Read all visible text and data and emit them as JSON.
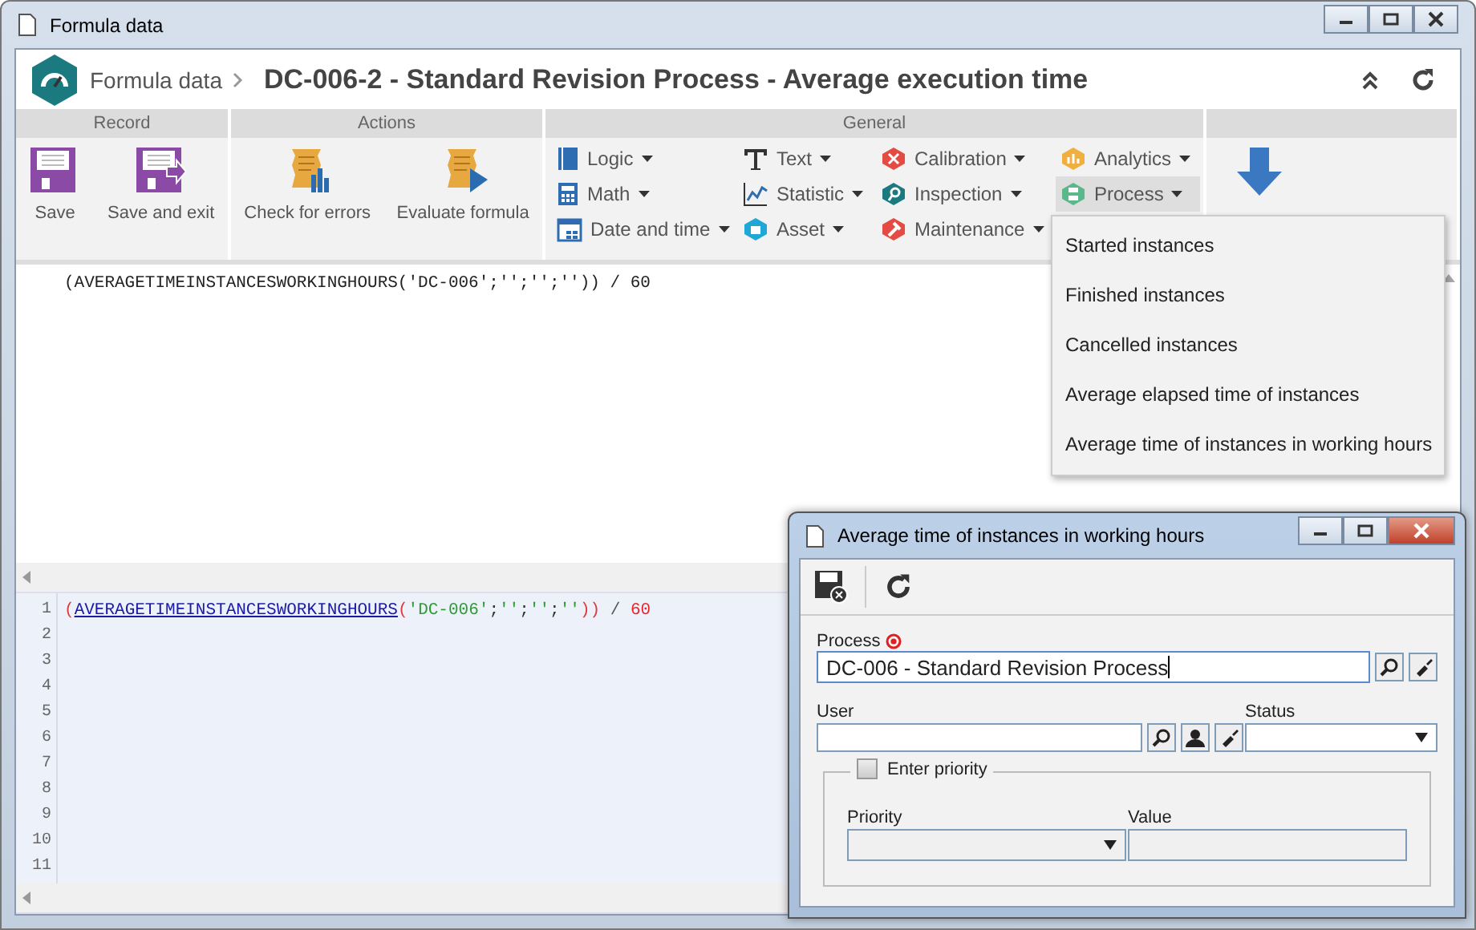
{
  "window": {
    "title": "Formula data"
  },
  "header": {
    "breadcrumb": "Formula data",
    "title": "DC-006-2 - Standard Revision Process - Average execution time"
  },
  "ribbon": {
    "groups": [
      {
        "title": "Record",
        "buttons": [
          {
            "label": "Save"
          },
          {
            "label": "Save and exit"
          }
        ]
      },
      {
        "title": "Actions",
        "buttons": [
          {
            "label": "Check for errors"
          },
          {
            "label": "Evaluate formula"
          }
        ]
      }
    ],
    "general": {
      "title": "General",
      "columns": [
        [
          {
            "label": "Logic",
            "expanded": false
          },
          {
            "label": "Math",
            "expanded": false
          },
          {
            "label": "Date and time",
            "expanded": false
          }
        ],
        [
          {
            "label": "Text",
            "expanded": false
          },
          {
            "label": "Statistic",
            "expanded": false
          },
          {
            "label": "Asset",
            "expanded": false
          }
        ],
        [
          {
            "label": "Calibration",
            "expanded": false
          },
          {
            "label": "Inspection",
            "expanded": false
          },
          {
            "label": "Maintenance",
            "expanded": false
          }
        ],
        [
          {
            "label": "Analytics",
            "expanded": false
          },
          {
            "label": "Process",
            "expanded": true
          }
        ]
      ]
    }
  },
  "formula_preview": "(AVERAGETIMEINSTANCESWORKINGHOURS('DC-006';'';'';'')) / 60",
  "code_editor": {
    "lines": [
      {
        "number": "1",
        "tokens": [
          {
            "kind": "paren",
            "text": "("
          },
          {
            "kind": "function",
            "text": "AVERAGETIMEINSTANCESWORKINGHOURS"
          },
          {
            "kind": "paren",
            "text": "("
          },
          {
            "kind": "string",
            "text": "'DC-006'"
          },
          {
            "kind": "punct",
            "text": ";"
          },
          {
            "kind": "string",
            "text": "''"
          },
          {
            "kind": "punct",
            "text": ";"
          },
          {
            "kind": "string",
            "text": "''"
          },
          {
            "kind": "punct",
            "text": ";"
          },
          {
            "kind": "string",
            "text": "''"
          },
          {
            "kind": "paren",
            "text": "))"
          },
          {
            "kind": "operator",
            "text": " / "
          },
          {
            "kind": "number",
            "text": "60"
          }
        ]
      },
      {
        "number": "2"
      },
      {
        "number": "3"
      },
      {
        "number": "4"
      },
      {
        "number": "5"
      },
      {
        "number": "6"
      },
      {
        "number": "7"
      },
      {
        "number": "8"
      },
      {
        "number": "9"
      },
      {
        "number": "10"
      },
      {
        "number": "11"
      }
    ]
  },
  "process_menu": {
    "items": [
      {
        "label": "Started instances"
      },
      {
        "label": "Finished instances"
      },
      {
        "label": "Cancelled instances"
      },
      {
        "label": "Average elapsed time of instances"
      },
      {
        "label": "Average time of instances in working hours"
      }
    ]
  },
  "dialog": {
    "title": "Average time of instances in working hours",
    "process": {
      "label": "Process",
      "required": true,
      "value": "DC-006 - Standard Revision Process"
    },
    "user": {
      "label": "User"
    },
    "status": {
      "label": "Status"
    },
    "priority_group": {
      "label": "Enter priority",
      "checked": false,
      "priority": {
        "label": "Priority"
      },
      "value": {
        "label": "Value"
      }
    }
  }
}
